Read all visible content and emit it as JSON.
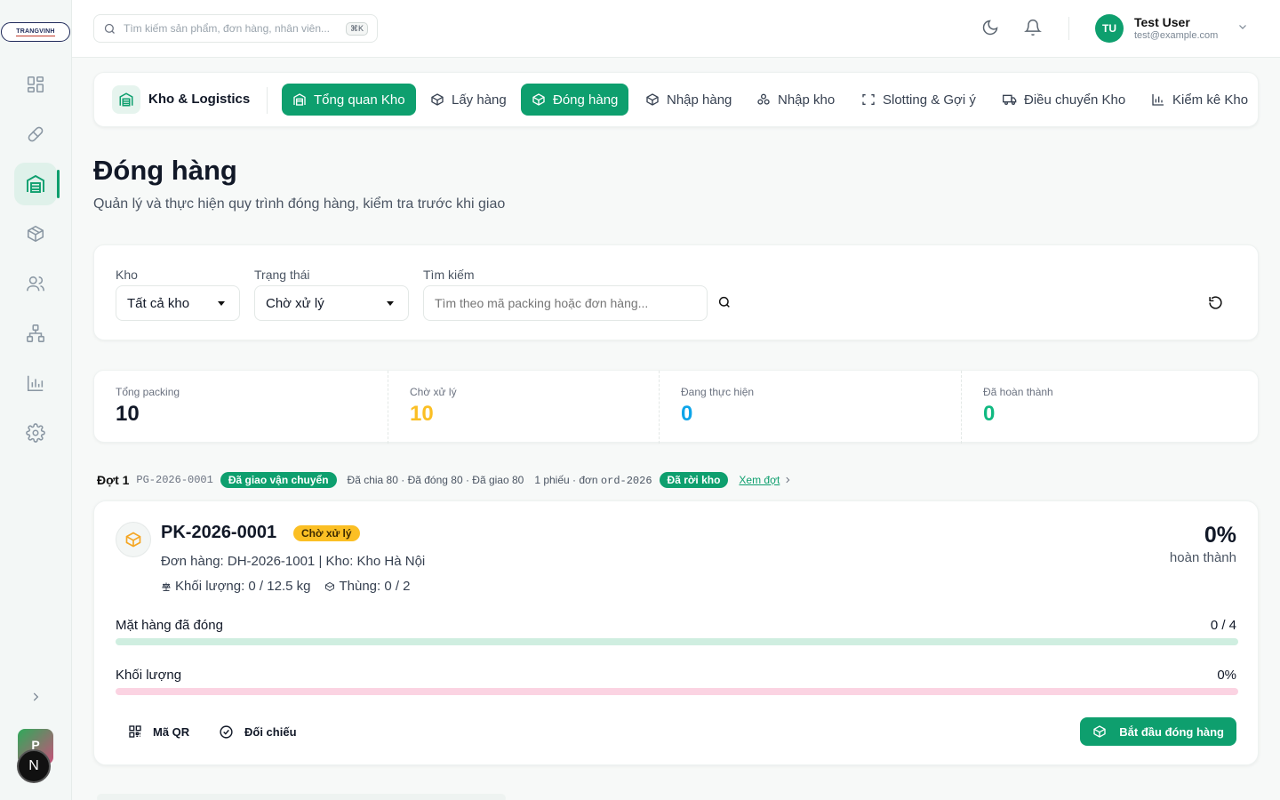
{
  "brand": {
    "logo_text": "TRANGVINH"
  },
  "sidebar": {
    "items": [
      {
        "name": "dashboard",
        "icon": "grid-icon"
      },
      {
        "name": "products",
        "icon": "pill-icon"
      },
      {
        "name": "warehouse",
        "icon": "warehouse-icon",
        "active": true
      },
      {
        "name": "inventory",
        "icon": "box-icon"
      },
      {
        "name": "users",
        "icon": "users-icon"
      },
      {
        "name": "organization",
        "icon": "hierarchy-icon"
      },
      {
        "name": "reports",
        "icon": "chart-icon"
      },
      {
        "name": "settings",
        "icon": "gear-icon"
      }
    ],
    "workspace_initial": "P",
    "user_initial": "N"
  },
  "topbar": {
    "search_placeholder": "Tìm kiếm sản phẩm, đơn hàng, nhân viên...",
    "shortcut": "⌘K",
    "user": {
      "initials": "TU",
      "name": "Test User",
      "email": "test@example.com"
    }
  },
  "module": {
    "name": "Kho & Logistics",
    "tabs": [
      {
        "label": "Tổng quan Kho",
        "active": true
      },
      {
        "label": "Lấy hàng",
        "active": false
      },
      {
        "label": "Đóng hàng",
        "active": true
      },
      {
        "label": "Nhập hàng",
        "active": false
      },
      {
        "label": "Nhập kho",
        "active": false
      },
      {
        "label": "Slotting & Gợi ý",
        "active": false
      },
      {
        "label": "Điều chuyển Kho",
        "active": false
      },
      {
        "label": "Kiểm kê Kho",
        "active": false
      }
    ]
  },
  "page": {
    "title": "Đóng hàng",
    "subtitle": "Quản lý và thực hiện quy trình đóng hàng, kiểm tra trước khi giao"
  },
  "filters": {
    "warehouse_label": "Kho",
    "warehouse_value": "Tất cả kho",
    "status_label": "Trạng thái",
    "status_value": "Chờ xử lý",
    "search_label": "Tìm kiếm",
    "search_placeholder": "Tìm theo mã packing hoặc đơn hàng..."
  },
  "stats": [
    {
      "label": "Tổng packing",
      "value": "10",
      "color": "#111827"
    },
    {
      "label": "Chờ xử lý",
      "value": "10",
      "color": "#fbbf24"
    },
    {
      "label": "Đang thực hiện",
      "value": "0",
      "color": "#0ea5e9"
    },
    {
      "label": "Đã hoàn thành",
      "value": "0",
      "color": "#10b981"
    }
  ],
  "batch": {
    "title": "Đợt 1",
    "code": "PG-2026-0001",
    "status": "Đã giao vận chuyển",
    "summary": "Đã chia 80 · Đã đóng 80 · Đã giao 80",
    "orders_prefix": "1 phiếu · đơn",
    "orders_code": "ord-2026",
    "exit_status": "Đã rời kho",
    "view_link": "Xem đợt"
  },
  "packing": {
    "code": "PK-2026-0001",
    "status": "Chờ xử lý",
    "meta": "Đơn hàng: DH-2026-1001 | Kho: Kho Hà Nội",
    "weight": "Khối lượng: 0 / 12.5 kg",
    "boxes": "Thùng: 0 / 2",
    "percent": "0%",
    "percent_label": "hoàn thành",
    "items_label": "Mặt hàng đã đóng",
    "items_value": "0 / 4",
    "items_progress": 0,
    "weight_label": "Khối lượng",
    "weight_value": "0%",
    "weight_progress": 0,
    "qr_label": "Mã QR",
    "verify_label": "Đối chiếu",
    "start_label": "Bắt đầu đóng hàng"
  },
  "colors": {
    "accent": "#0e9f6e",
    "warning": "#fbbf24",
    "items_bar": "#cfeee0",
    "weight_bar": "#fbd3e2"
  }
}
